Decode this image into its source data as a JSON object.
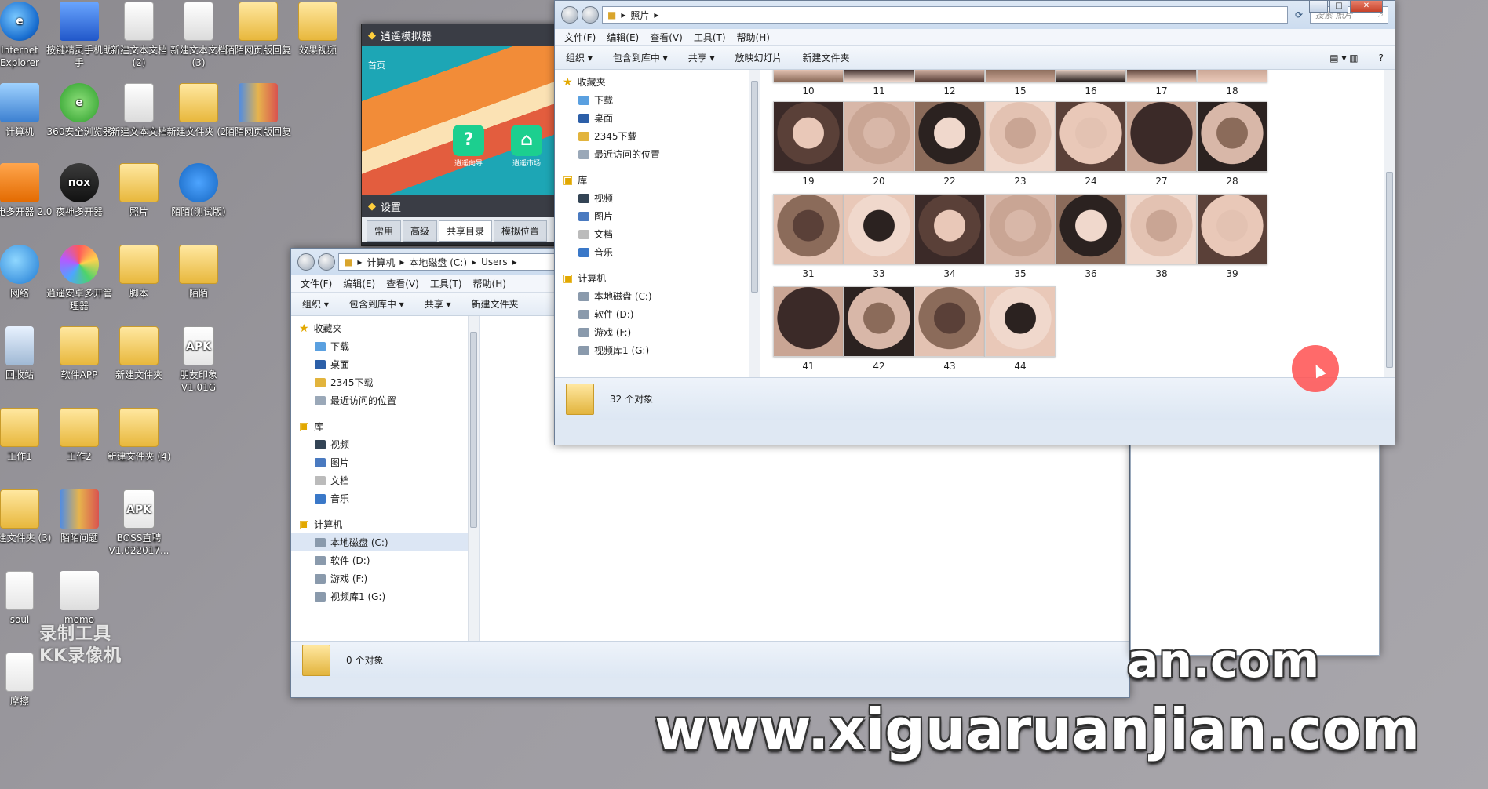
{
  "desktop": {
    "icons": [
      {
        "label": "Internet Explorer",
        "glyph": "g-ie",
        "char": "e"
      },
      {
        "label": "按键精灵手机助手",
        "glyph": "g-app",
        "char": ""
      },
      {
        "label": "新建文本文档 (2)",
        "glyph": "g-doc",
        "char": ""
      },
      {
        "label": "新建文本文档 (3)",
        "glyph": "g-doc",
        "char": ""
      },
      {
        "label": "陌陌网页版回复",
        "glyph": "g-folder",
        "char": ""
      },
      {
        "label": "效果视频",
        "glyph": "g-folder",
        "char": ""
      },
      {
        "label": "计算机",
        "glyph": "g-pc",
        "char": ""
      },
      {
        "label": "360安全浏览器",
        "glyph": "g-360",
        "char": "e"
      },
      {
        "label": "新建文本文档",
        "glyph": "g-doc",
        "char": ""
      },
      {
        "label": "新建文件夹 (2)",
        "glyph": "g-folder",
        "char": ""
      },
      {
        "label": "陌陌网页版回复",
        "glyph": "g-rar",
        "char": ""
      },
      {
        "label": "雷电多开器 2.0",
        "glyph": "g-orange",
        "char": ""
      },
      {
        "label": "夜神多开器",
        "glyph": "g-nox",
        "char": "nox"
      },
      {
        "label": "照片",
        "glyph": "g-folder",
        "char": ""
      },
      {
        "label": "陌陌(测试版)",
        "glyph": "g-blue",
        "char": ""
      },
      {
        "label": "网络",
        "glyph": "g-globe",
        "char": ""
      },
      {
        "label": "逍遥安卓多开管理器",
        "glyph": "g-pin",
        "char": ""
      },
      {
        "label": "脚本",
        "glyph": "g-folder",
        "char": ""
      },
      {
        "label": "陌陌",
        "glyph": "g-folder",
        "char": ""
      },
      {
        "label": "回收站",
        "glyph": "g-bin",
        "char": ""
      },
      {
        "label": "软件APP",
        "glyph": "g-folder",
        "char": ""
      },
      {
        "label": "新建文件夹",
        "glyph": "g-folder",
        "char": ""
      },
      {
        "label": "朋友印象 V1.01G",
        "glyph": "g-apk",
        "char": "APK"
      },
      {
        "label": "工作1",
        "glyph": "g-folder",
        "char": ""
      },
      {
        "label": "工作2",
        "glyph": "g-folder",
        "char": ""
      },
      {
        "label": "新建文件夹 (4)",
        "glyph": "g-folder",
        "char": ""
      },
      {
        "label": "新建文件夹 (3)",
        "glyph": "g-folder",
        "char": ""
      },
      {
        "label": "陌陌问题",
        "glyph": "g-rar",
        "char": ""
      },
      {
        "label": "BOSS直聘 V1.022017...",
        "glyph": "g-apk",
        "char": "APK"
      },
      {
        "label": "soul",
        "glyph": "g-soul",
        "char": ""
      },
      {
        "label": "momo",
        "glyph": "g-momo",
        "char": ""
      },
      {
        "label": "摩擦",
        "glyph": "g-soul",
        "char": ""
      }
    ],
    "watermark_small_1": "录制工具",
    "watermark_small_2": "KK录像机",
    "watermark_big": "www.xiguaruanjian.com",
    "watermark_partial": "an.com"
  },
  "simulator": {
    "title": "逍遥模拟器",
    "home_label": "首页",
    "app1": "逍遥向导",
    "app2": "逍遥市场",
    "settings_title": "设置",
    "tabs": [
      "常用",
      "高级",
      "共享目录",
      "模拟位置"
    ]
  },
  "explorer_back": {
    "breadcrumb": [
      "计算机",
      "本地磁盘 (C:)",
      "Users"
    ],
    "menu": [
      "文件(F)",
      "编辑(E)",
      "查看(V)",
      "工具(T)",
      "帮助(H)"
    ],
    "toolbar": [
      "组织 ▾",
      "包含到库中 ▾",
      "共享 ▾",
      "新建文件夹"
    ],
    "status": "0 个对象"
  },
  "explorer_front": {
    "breadcrumb": [
      "照片"
    ],
    "search_placeholder": "搜索 照片",
    "menu": [
      "文件(F)",
      "编辑(E)",
      "查看(V)",
      "工具(T)",
      "帮助(H)"
    ],
    "toolbar": [
      "组织 ▾",
      "包含到库中 ▾",
      "共享 ▾",
      "放映幻灯片",
      "新建文件夹"
    ],
    "status": "32 个对象",
    "photos_top": [
      "10",
      "11",
      "12",
      "15",
      "16",
      "17",
      "18"
    ],
    "photos": [
      "19",
      "20",
      "22",
      "23",
      "24",
      "27",
      "28",
      "31",
      "33",
      "34",
      "35",
      "36",
      "38",
      "39",
      "41",
      "42",
      "43",
      "44"
    ]
  },
  "nav": {
    "favorites": "收藏夹",
    "fav_items": [
      "下载",
      "桌面",
      "2345下载",
      "最近访问的位置"
    ],
    "library": "库",
    "lib_items": [
      "视频",
      "图片",
      "文档",
      "音乐"
    ],
    "computer": "计算机",
    "drives": [
      "本地磁盘 (C:)",
      "软件 (D:)",
      "游戏 (F:)",
      "视频库1 (G:)"
    ]
  }
}
